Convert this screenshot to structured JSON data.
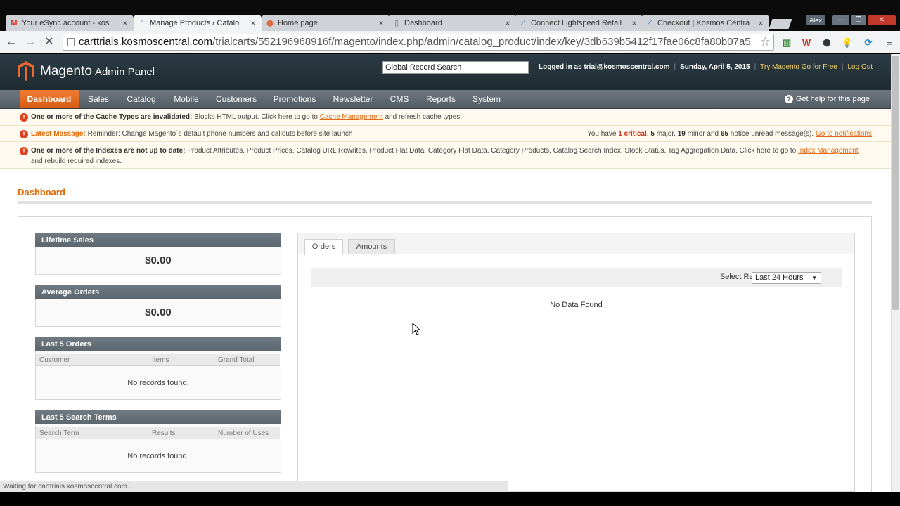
{
  "browser": {
    "tabs": [
      {
        "label": "Your eSync account - kos",
        "icon": "gmail-icon"
      },
      {
        "label": "Manage Products / Catalo",
        "icon": "loading-icon",
        "active": true
      },
      {
        "label": "Home page",
        "icon": "magento-icon"
      },
      {
        "label": "Dashboard",
        "icon": "page-icon"
      },
      {
        "label": "Connect Lightspeed Retail",
        "icon": "feather-icon"
      },
      {
        "label": "Checkout | Kosmos Centra",
        "icon": "feather-icon"
      }
    ],
    "user": "Alex",
    "url_host": "carttrials.kosmoscentral.com",
    "url_path": "/trialcarts/552196968916f/magento/index.php/admin/catalog_product/index/key/3db639b5412f17fae06c8fa80b07a5",
    "status_text": "Waiting for carttrials.kosmoscentral.com..."
  },
  "header": {
    "logo": "Magento",
    "logo_sub": "Admin Panel",
    "search_value": "Global Record Search",
    "logged_in": "Logged in as trial@kosmoscentral.com",
    "date": "Sunday, April 5, 2015",
    "try_link": "Try Magento Go for Free",
    "logout": "Log Out"
  },
  "nav": {
    "items": [
      "Dashboard",
      "Sales",
      "Catalog",
      "Mobile",
      "Customers",
      "Promotions",
      "Newsletter",
      "CMS",
      "Reports",
      "System"
    ],
    "help": "Get help for this page"
  },
  "notices": {
    "cache_bold": "One or more of the Cache Types are invalidated:",
    "cache_text": "Blocks HTML output. Click here to go to",
    "cache_link": "Cache Management",
    "cache_tail": "and refresh cache types.",
    "latest_label": "Latest Message:",
    "latest_text": "Reminder: Change Magento`s default phone numbers and callouts before site launch",
    "summary_pre": "You have",
    "summary_critical": "1 critical",
    "summary_major_n": "5",
    "summary_major": "major,",
    "summary_minor_n": "19",
    "summary_minor": "minor and",
    "summary_notice_n": "65",
    "summary_notice": "notice unread message(s).",
    "summary_link": "Go to notifications",
    "index_bold": "One or more of the Indexes are not up to date:",
    "index_text": "Product Attributes, Product Prices, Catalog URL Rewrites, Product Flat Data, Category Flat Data, Category Products, Catalog Search Index, Stock Status, Tag Aggregation Data. Click here to go to",
    "index_link": "Index Management",
    "index_tail": "and rebuild required indexes."
  },
  "dashboard": {
    "title": "Dashboard",
    "lifetime_label": "Lifetime Sales",
    "lifetime_value": "$0.00",
    "average_label": "Average Orders",
    "average_value": "$0.00",
    "last_orders": {
      "title": "Last 5 Orders",
      "columns": [
        "Customer",
        "Items",
        "Grand Total"
      ],
      "empty": "No records found."
    },
    "last_search": {
      "title": "Last 5 Search Terms",
      "columns": [
        "Search Term",
        "Results",
        "Number of Uses"
      ],
      "empty": "No records found."
    },
    "chart": {
      "tabs": [
        "Orders",
        "Amounts"
      ],
      "range_label": "Select Range:",
      "range_value": "Last 24 Hours",
      "empty": "No Data Found"
    }
  }
}
